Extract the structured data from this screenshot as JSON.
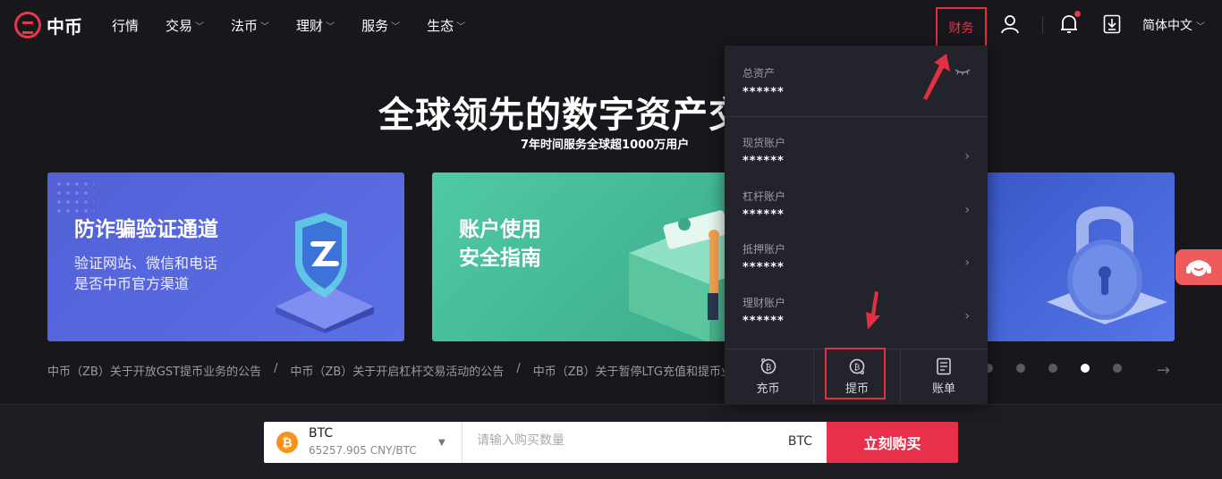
{
  "header": {
    "logo_text": "中币",
    "nav": [
      {
        "label": "行情",
        "dropdown": false
      },
      {
        "label": "交易",
        "dropdown": true
      },
      {
        "label": "法币",
        "dropdown": true
      },
      {
        "label": "理财",
        "dropdown": true
      },
      {
        "label": "服务",
        "dropdown": true
      },
      {
        "label": "生态",
        "dropdown": true
      }
    ],
    "finance_label": "财务",
    "language": "简体中文",
    "accent_color": "#e8364a"
  },
  "hero": {
    "title": "全球领先的数字资产交",
    "subtitle": "7年时间服务全球超1000万用户"
  },
  "banners": [
    {
      "title": "防诈骗验证通道",
      "desc_line1": "验证网站、微信和电话",
      "desc_line2": "是否中币官方渠道"
    },
    {
      "title_line1": "账户使用",
      "title_line2": "安全指南"
    }
  ],
  "announcements": [
    "中币（ZB）关于开放GST提币业务的公告",
    "中币（ZB）关于开启杠杆交易活动的公告",
    "中币（ZB）关于暂停LTG充值和提币业务"
  ],
  "announcement_separator": "/",
  "pager": {
    "count": 5,
    "active_index": 3
  },
  "buy_bar": {
    "coin": "BTC",
    "price": "65257.905 CNY/BTC",
    "amount_placeholder": "请输入购买数量",
    "unit": "BTC",
    "buy_label": "立刻购买"
  },
  "finance_panel": {
    "total_label": "总资产",
    "total_value": "******",
    "accounts": [
      {
        "label": "现货账户",
        "value": "******"
      },
      {
        "label": "杠杆账户",
        "value": "******"
      },
      {
        "label": "抵押账户",
        "value": "******"
      },
      {
        "label": "理财账户",
        "value": "******"
      }
    ],
    "actions": [
      {
        "label": "充币",
        "icon": "deposit-icon"
      },
      {
        "label": "提币",
        "icon": "withdraw-icon"
      },
      {
        "label": "账单",
        "icon": "bill-icon"
      }
    ]
  }
}
